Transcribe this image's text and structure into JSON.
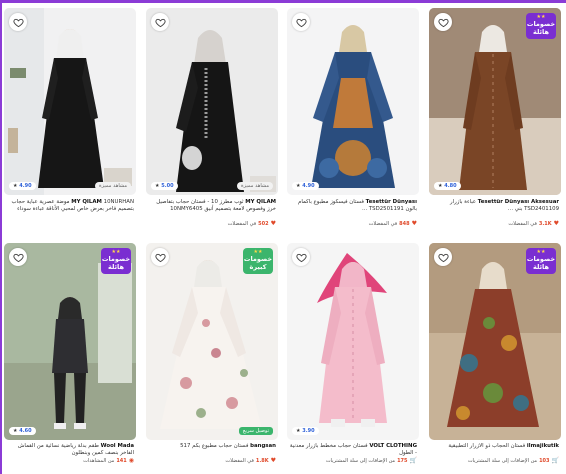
{
  "colors": {
    "deal": "#7a2ed1",
    "deal_green": "#3bb56c",
    "accent": "#e04a2b",
    "frame": "#8b3bd6"
  },
  "products": [
    {
      "title_brand": "MY QILAM",
      "title_text": "10NURHAN موضة عصرية عباية حجاب بتصميم فاخر بعرض خاص لمحبي الأناقة عباءة سوداء",
      "rating_badge": "4.90",
      "tag": "مشاهد مميزة",
      "deal": null,
      "meta_count": "",
      "meta_label": "",
      "photo_bg": "#efeff0"
    },
    {
      "title_brand": "MY QILAM",
      "title_text": "ثوب مطرز 10 - فستان حجاب بتفاصيل خرز وفصوص لامعة بتصميم أنيق 10NMY6405",
      "rating_badge": "5.00",
      "tag": "مشاهد مميزة",
      "deal": null,
      "meta_count": "502",
      "meta_label": "في المفضلات",
      "photo_bg": "#ececec"
    },
    {
      "title_brand": "Tesettür Dünyası",
      "title_text": "فستان فيسكوز مطبوع بأكمام بالون TSD2501191 ...",
      "rating_badge": "4.90",
      "tag": "",
      "deal": null,
      "meta_count": "848",
      "meta_label": "في المفضلات",
      "photo_bg": "#f3f3f4"
    },
    {
      "title_brand": "Tesettür Dünyası Aksesuar",
      "title_text": "عباءة بأزرار TSD2401109 بني ...",
      "rating_badge": "4.80",
      "tag": "",
      "deal": {
        "line1": "خصومات",
        "line2": "هائلة"
      },
      "meta_count": "3.1K",
      "meta_label": "في المفضلات",
      "photo_bg": "#b8a695"
    },
    {
      "title_brand": "Wool Mada",
      "title_text": "طقم بدلة رياضية نسائية من القماش الفاخر بنصف كمين وبنطلون",
      "rating_badge": "4.60",
      "tag": "",
      "deal": {
        "line1": "خصومات",
        "line2": "هائلة"
      },
      "meta_count": "141",
      "meta_label": "من المشاهدات",
      "photo_bg": "#cfd6c6"
    },
    {
      "title_brand": "bangsan",
      "title_text": "فستان حجاب مطبوع بكم 517",
      "rating_badge": "",
      "tag": "توصيل سريع",
      "deal": {
        "line1": "خصومات",
        "line2": "كبيرة",
        "green": true
      },
      "meta_count": "1.8K",
      "meta_label": "في المفضلات",
      "photo_bg": "#f3f1ef"
    },
    {
      "title_brand": "VOLT CLOTHING",
      "title_text": "فستان حجاب مخطط بأزرار معدنية - الطول",
      "rating_badge": "3.90",
      "tag": "",
      "deal": null,
      "meta_count": "175",
      "meta_label": "من الإضافات إلى سلة المشتريات",
      "photo_bg": "#f5f5f5"
    },
    {
      "title_brand": "ilmajikutik",
      "title_text": "فستان الحجاب ذو الأزرار التطبيقية",
      "rating_badge": "",
      "tag": "",
      "deal": {
        "line1": "خصومات",
        "line2": "هائلة"
      },
      "meta_count": "103",
      "meta_label": "من الإضافات إلى سلة المشتريات",
      "photo_bg": "#c9b59a"
    }
  ]
}
